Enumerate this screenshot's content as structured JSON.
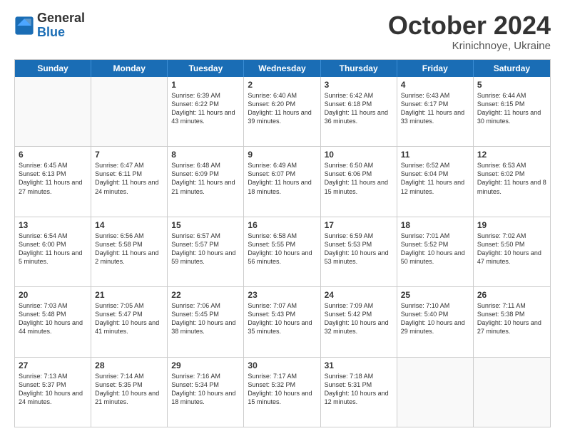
{
  "logo": {
    "general": "General",
    "blue": "Blue"
  },
  "title": "October 2024",
  "location": "Krinichnoye, Ukraine",
  "days": [
    "Sunday",
    "Monday",
    "Tuesday",
    "Wednesday",
    "Thursday",
    "Friday",
    "Saturday"
  ],
  "weeks": [
    [
      {
        "day": "",
        "info": ""
      },
      {
        "day": "",
        "info": ""
      },
      {
        "day": "1",
        "info": "Sunrise: 6:39 AM\nSunset: 6:22 PM\nDaylight: 11 hours and 43 minutes."
      },
      {
        "day": "2",
        "info": "Sunrise: 6:40 AM\nSunset: 6:20 PM\nDaylight: 11 hours and 39 minutes."
      },
      {
        "day": "3",
        "info": "Sunrise: 6:42 AM\nSunset: 6:18 PM\nDaylight: 11 hours and 36 minutes."
      },
      {
        "day": "4",
        "info": "Sunrise: 6:43 AM\nSunset: 6:17 PM\nDaylight: 11 hours and 33 minutes."
      },
      {
        "day": "5",
        "info": "Sunrise: 6:44 AM\nSunset: 6:15 PM\nDaylight: 11 hours and 30 minutes."
      }
    ],
    [
      {
        "day": "6",
        "info": "Sunrise: 6:45 AM\nSunset: 6:13 PM\nDaylight: 11 hours and 27 minutes."
      },
      {
        "day": "7",
        "info": "Sunrise: 6:47 AM\nSunset: 6:11 PM\nDaylight: 11 hours and 24 minutes."
      },
      {
        "day": "8",
        "info": "Sunrise: 6:48 AM\nSunset: 6:09 PM\nDaylight: 11 hours and 21 minutes."
      },
      {
        "day": "9",
        "info": "Sunrise: 6:49 AM\nSunset: 6:07 PM\nDaylight: 11 hours and 18 minutes."
      },
      {
        "day": "10",
        "info": "Sunrise: 6:50 AM\nSunset: 6:06 PM\nDaylight: 11 hours and 15 minutes."
      },
      {
        "day": "11",
        "info": "Sunrise: 6:52 AM\nSunset: 6:04 PM\nDaylight: 11 hours and 12 minutes."
      },
      {
        "day": "12",
        "info": "Sunrise: 6:53 AM\nSunset: 6:02 PM\nDaylight: 11 hours and 8 minutes."
      }
    ],
    [
      {
        "day": "13",
        "info": "Sunrise: 6:54 AM\nSunset: 6:00 PM\nDaylight: 11 hours and 5 minutes."
      },
      {
        "day": "14",
        "info": "Sunrise: 6:56 AM\nSunset: 5:58 PM\nDaylight: 11 hours and 2 minutes."
      },
      {
        "day": "15",
        "info": "Sunrise: 6:57 AM\nSunset: 5:57 PM\nDaylight: 10 hours and 59 minutes."
      },
      {
        "day": "16",
        "info": "Sunrise: 6:58 AM\nSunset: 5:55 PM\nDaylight: 10 hours and 56 minutes."
      },
      {
        "day": "17",
        "info": "Sunrise: 6:59 AM\nSunset: 5:53 PM\nDaylight: 10 hours and 53 minutes."
      },
      {
        "day": "18",
        "info": "Sunrise: 7:01 AM\nSunset: 5:52 PM\nDaylight: 10 hours and 50 minutes."
      },
      {
        "day": "19",
        "info": "Sunrise: 7:02 AM\nSunset: 5:50 PM\nDaylight: 10 hours and 47 minutes."
      }
    ],
    [
      {
        "day": "20",
        "info": "Sunrise: 7:03 AM\nSunset: 5:48 PM\nDaylight: 10 hours and 44 minutes."
      },
      {
        "day": "21",
        "info": "Sunrise: 7:05 AM\nSunset: 5:47 PM\nDaylight: 10 hours and 41 minutes."
      },
      {
        "day": "22",
        "info": "Sunrise: 7:06 AM\nSunset: 5:45 PM\nDaylight: 10 hours and 38 minutes."
      },
      {
        "day": "23",
        "info": "Sunrise: 7:07 AM\nSunset: 5:43 PM\nDaylight: 10 hours and 35 minutes."
      },
      {
        "day": "24",
        "info": "Sunrise: 7:09 AM\nSunset: 5:42 PM\nDaylight: 10 hours and 32 minutes."
      },
      {
        "day": "25",
        "info": "Sunrise: 7:10 AM\nSunset: 5:40 PM\nDaylight: 10 hours and 29 minutes."
      },
      {
        "day": "26",
        "info": "Sunrise: 7:11 AM\nSunset: 5:38 PM\nDaylight: 10 hours and 27 minutes."
      }
    ],
    [
      {
        "day": "27",
        "info": "Sunrise: 7:13 AM\nSunset: 5:37 PM\nDaylight: 10 hours and 24 minutes."
      },
      {
        "day": "28",
        "info": "Sunrise: 7:14 AM\nSunset: 5:35 PM\nDaylight: 10 hours and 21 minutes."
      },
      {
        "day": "29",
        "info": "Sunrise: 7:16 AM\nSunset: 5:34 PM\nDaylight: 10 hours and 18 minutes."
      },
      {
        "day": "30",
        "info": "Sunrise: 7:17 AM\nSunset: 5:32 PM\nDaylight: 10 hours and 15 minutes."
      },
      {
        "day": "31",
        "info": "Sunrise: 7:18 AM\nSunset: 5:31 PM\nDaylight: 10 hours and 12 minutes."
      },
      {
        "day": "",
        "info": ""
      },
      {
        "day": "",
        "info": ""
      }
    ]
  ]
}
